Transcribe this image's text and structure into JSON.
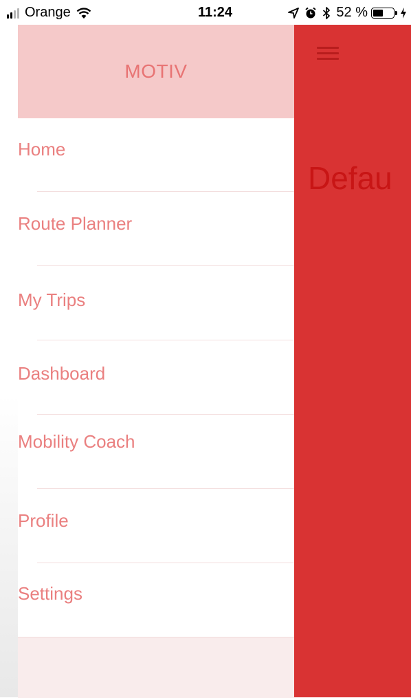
{
  "status_bar": {
    "carrier": "Orange",
    "time": "11:24",
    "battery_text": "52 %",
    "battery_level": 0.52,
    "icons": [
      "signal-icon",
      "wifi-icon",
      "location-icon",
      "alarm-icon",
      "bluetooth-icon",
      "battery-icon",
      "charging-icon"
    ]
  },
  "drawer": {
    "title": "MOTIV",
    "items": [
      {
        "label": "Home"
      },
      {
        "label": "Route Planner"
      },
      {
        "label": "My Trips"
      },
      {
        "label": "Dashboard"
      },
      {
        "label": "Mobility Coach"
      },
      {
        "label": "Profile"
      },
      {
        "label": "Settings"
      }
    ]
  },
  "main": {
    "title": "Defau"
  },
  "colors": {
    "accent": "#d93333",
    "header_bg": "#f5c9c9",
    "menu_text": "#ea8080",
    "title_text": "#c81515"
  }
}
